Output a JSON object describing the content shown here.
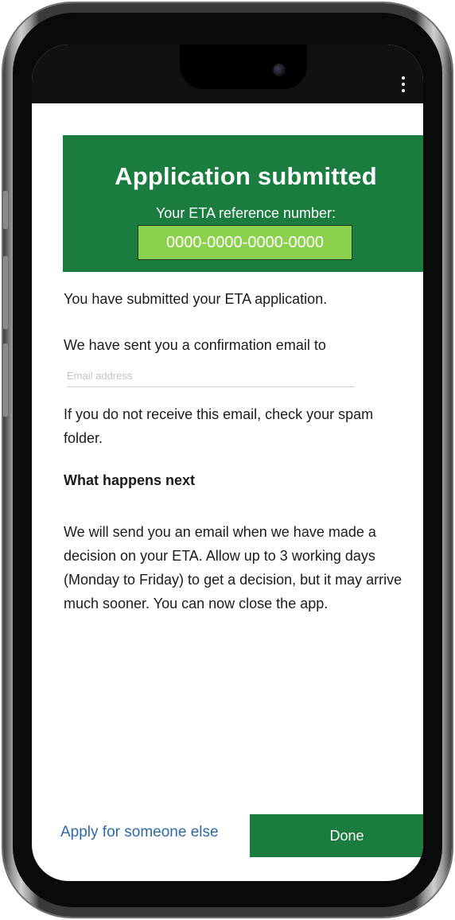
{
  "header": {
    "menu_icon": "more-vertical-icon"
  },
  "confirmation": {
    "title": "Application submitted",
    "reference_label": "Your ETA reference number:",
    "reference_number": "0000-0000-0000-0000"
  },
  "content": {
    "submitted_text": "You have submitted your ETA application.",
    "email_sent_text": "We have sent you a confirmation email to",
    "email_placeholder": "Email address",
    "spam_text": "If you do not receive this email, check your spam folder.",
    "next_heading": "What happens next",
    "next_text": "We will send you an email when we have made a decision on your ETA. Allow up to 3 working days (Monday to Friday) to get a decision, but it may arrive much sooner. You can now close the app."
  },
  "footer": {
    "apply_link": "Apply for someone else",
    "done_button": "Done"
  },
  "colors": {
    "brand_green": "#1a7c3e",
    "reference_box": "#8cd14e",
    "link_blue": "#2c6aa6"
  }
}
